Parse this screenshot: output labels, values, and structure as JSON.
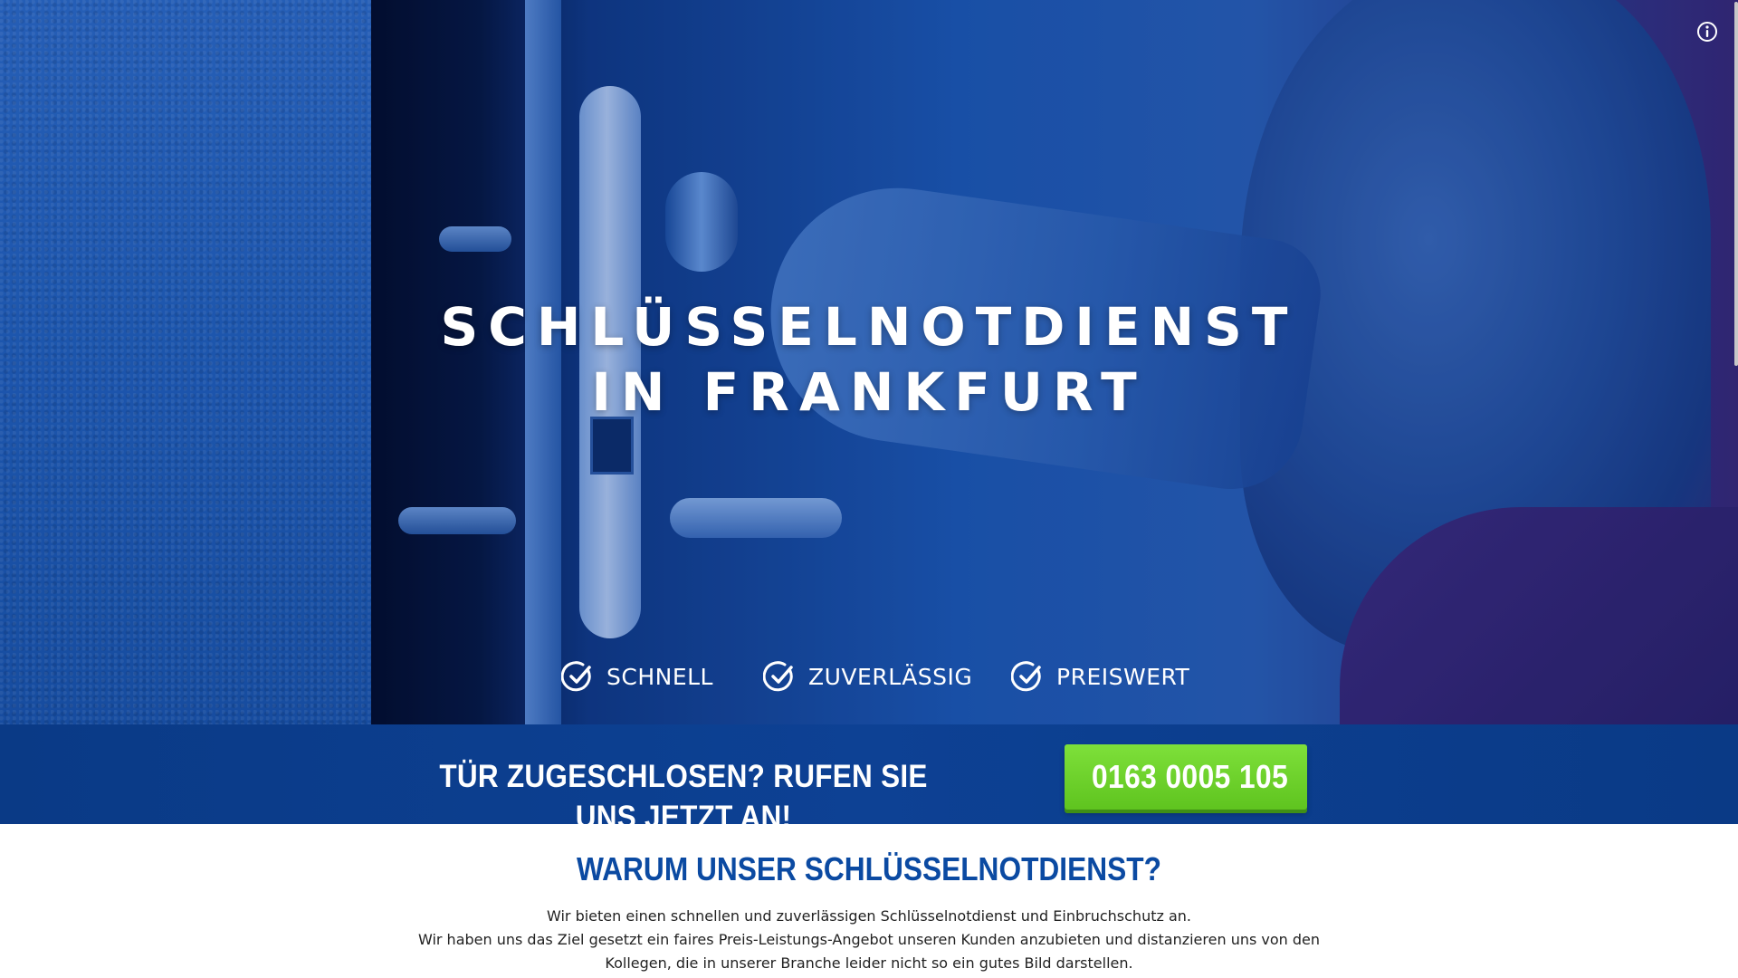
{
  "hero": {
    "title_line1": "SCHLÜSSELNOTDIENST",
    "title_line2": "IN FRANKFURT",
    "features": [
      {
        "label": "SCHNELL",
        "icon": "check-circle-icon"
      },
      {
        "label": "ZUVERLÄSSIG",
        "icon": "check-circle-icon"
      },
      {
        "label": "PREISWERT",
        "icon": "check-circle-icon"
      }
    ],
    "info_icon": "info-circle-icon"
  },
  "cta": {
    "text": "TÜR ZUGESCHLOSEN? RUFEN SIE UNS JETZT AN!",
    "phone_number": "0163 0005 105",
    "phone_icon": "phone-icon",
    "button_color": "#6fd22c",
    "bar_color": "#0d4194"
  },
  "why": {
    "title": "WARUM UNSER SCHLÜSSELNOTDIENST?",
    "lines": [
      "Wir bieten einen schnellen und zuverlässigen Schlüsselnotdienst und Einbruchschutz an.",
      "Wir haben uns das Ziel gesetzt ein faires Preis-Leistungs-Angebot unseren Kunden anzubieten und distanzieren uns von den",
      "Kollegen, die in unserer Branche leider nicht so ein gutes Bild darstellen."
    ],
    "title_color": "#0b4aa2"
  }
}
